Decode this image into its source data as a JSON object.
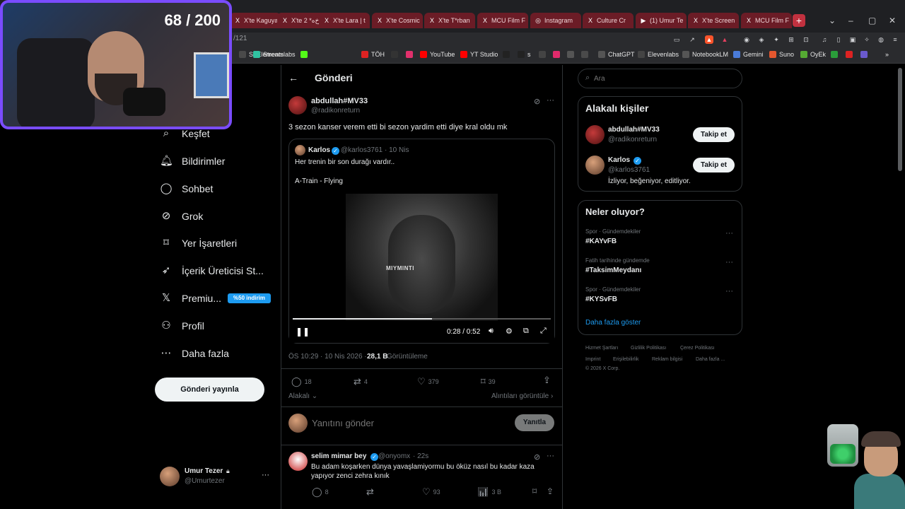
{
  "browser": {
    "tabs": [
      {
        "label": "X'te Kaguya",
        "icon": "X"
      },
      {
        "label": "X'te 2 *ه‌خ‌ه",
        "icon": "X"
      },
      {
        "label": "X'te Lara | t",
        "icon": "X"
      },
      {
        "label": "X'te Cosmic",
        "icon": "X"
      },
      {
        "label": "X'te T*rban",
        "icon": "X"
      },
      {
        "label": "MCU Film F",
        "icon": "X"
      },
      {
        "label": "Instagram",
        "icon": "◎"
      },
      {
        "label": "Culture Cr",
        "icon": "X"
      },
      {
        "label": "(1) Umur Te",
        "icon": "▶"
      },
      {
        "label": "X'te Screen",
        "icon": "X"
      },
      {
        "label": "MCU Film F",
        "icon": "X"
      }
    ],
    "new_tab": "+",
    "address": "/121",
    "bookmarks": [
      {
        "label": "STElements",
        "color": "#4a4a4a"
      },
      {
        "label": "Streamlabs",
        "color": "#31c3a2"
      },
      {
        "label": "",
        "color": "#53fc18"
      },
      {
        "label": "TÖH",
        "color": "#d22"
      },
      {
        "label": "",
        "color": "#333"
      },
      {
        "label": "",
        "color": "#e1306c"
      },
      {
        "label": "YouTube",
        "color": "#f00"
      },
      {
        "label": "YT Studio",
        "color": "#f00"
      },
      {
        "label": "",
        "color": "#222"
      },
      {
        "label": "s",
        "color": "#222"
      },
      {
        "label": "",
        "color": "#444"
      },
      {
        "label": "",
        "color": "#e02a6b"
      },
      {
        "label": "",
        "color": "#555"
      },
      {
        "label": "",
        "color": "#4a4a4a"
      },
      {
        "label": "ChatGPT",
        "color": "#555"
      },
      {
        "label": "Elevenlabs",
        "color": "#444"
      },
      {
        "label": "NotebookLM",
        "color": "#555"
      },
      {
        "label": "Gemini",
        "color": "#4a7bd8"
      },
      {
        "label": "Suno",
        "color": "#e4572e"
      },
      {
        "label": "OyEk",
        "color": "#5a3"
      },
      {
        "label": "",
        "color": "#2a9d3a"
      },
      {
        "label": "",
        "color": "#d22"
      },
      {
        "label": "",
        "color": "#6a5acd"
      }
    ]
  },
  "webcam": {
    "counter": "68 / 200"
  },
  "nav": {
    "items": [
      {
        "label": "Keşfet",
        "icon": "⌕",
        "name": "explore"
      },
      {
        "label": "Bildirimler",
        "icon": "🔔︎",
        "name": "notifications"
      },
      {
        "label": "Sohbet",
        "icon": "◯",
        "name": "chat"
      },
      {
        "label": "Grok",
        "icon": "⊘",
        "name": "grok"
      },
      {
        "label": "Yer İşaretleri",
        "icon": "⌑",
        "name": "bookmarks"
      },
      {
        "label": "İçerik Üreticisi St...",
        "icon": "➶",
        "name": "creator-studio"
      },
      {
        "label": "Premiu...",
        "icon": "𝕏",
        "name": "premium"
      },
      {
        "label": "Profil",
        "icon": "⚇",
        "name": "profile"
      },
      {
        "label": "Daha fazla",
        "icon": "⋯",
        "name": "more"
      }
    ],
    "premium_badge": "%50 indirim",
    "post_button": "Gönderi yayınla",
    "user": {
      "name": "Umur Tezer",
      "handle": "@Umurtezer",
      "more": "···"
    }
  },
  "post": {
    "header_title": "Gönderi",
    "back": "←",
    "author": {
      "name": "abdullah#MV33",
      "handle": "@radikonreturn"
    },
    "text": "3 sezon kanser verem etti bi sezon yardim etti diye kral oldu mk",
    "quote": {
      "name": "Karlos",
      "handle": "@karlos3761",
      "time": "· 10 Nis",
      "line1": "Her trenin bir son durağı vardır..",
      "line2": "A-Train - Flying",
      "video": {
        "watermark": "MIYMINTI",
        "time": "0:28 / 0:52",
        "progress": 0.54
      }
    },
    "meta": {
      "time": "ÖS 10:29 · 10 Nis 2026 · ",
      "views": "28,1 B",
      "views_label": " Görüntüleme"
    },
    "actions": {
      "replies": "18",
      "reposts": "4",
      "likes": "379",
      "bookmarks": "39"
    },
    "related": "Alakalı",
    "quotes_link": "Alıntıları görüntüle",
    "reply_placeholder": "Yanıtını gönder",
    "reply_button": "Yanıtla"
  },
  "reply": {
    "name": "selim mimar bey",
    "handle": "@onyomx",
    "time": "· 22s",
    "text": "Bu adam koşarken dünya yavaşlamiyormu bu öküz nasıl bu kadar kaza yapıyor zenci zehra kınık",
    "replies": "8",
    "likes": "93",
    "views": "3 B"
  },
  "sidebar": {
    "search_placeholder": "Ara",
    "relevant_title": "Alakalı kişiler",
    "people": [
      {
        "name": "abdullah#MV33",
        "handle": "@radikonreturn",
        "bio": "",
        "button": "Takip et"
      },
      {
        "name": "Karlos",
        "handle": "@karlos3761",
        "bio": "İzliyor, beğeniyor, editliyor.",
        "button": "Takip et"
      }
    ],
    "trends_title": "Neler oluyor?",
    "trends": [
      {
        "context": "Spor · Gündemdekiler",
        "tag": "#KAYvFB"
      },
      {
        "context": "Fatih tarihinde gündemde",
        "tag": "#TaksimMeydanı"
      },
      {
        "context": "Spor · Gündemdekiler",
        "tag": "#KYSvFB"
      }
    ],
    "show_more": "Daha fazla göster",
    "footer": {
      "terms": "Hizmet Şartları",
      "privacy": "Gizlilik Politikası",
      "cookies": "Çerez Politikası",
      "imprint": "Imprint",
      "accessibility": "Erişilebilirlik",
      "ads": "Reklam bilgisi",
      "more": "Daha fazla ...",
      "copyright": "© 2026 X Corp."
    }
  }
}
